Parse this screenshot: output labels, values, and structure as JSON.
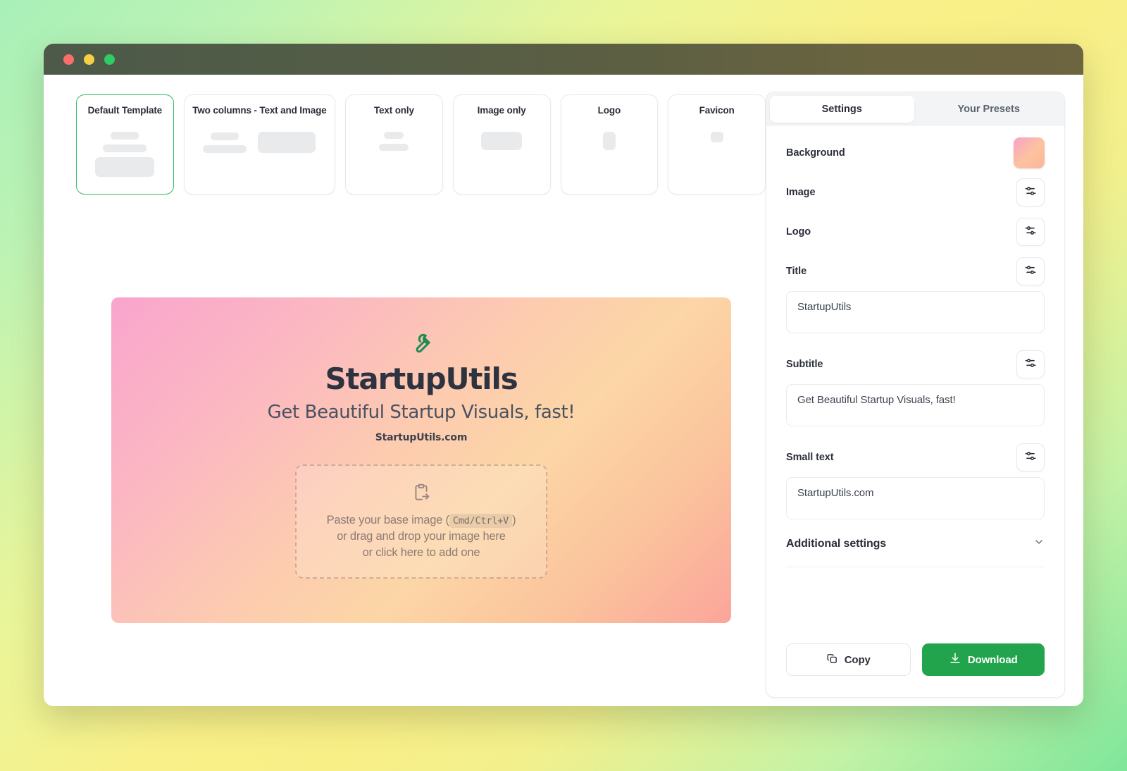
{
  "window": {
    "traffic_lights": [
      "close",
      "minimize",
      "zoom"
    ]
  },
  "templates": [
    {
      "label": "Default Template",
      "selected": true,
      "art": "stacked"
    },
    {
      "label": "Two columns - Text and Image",
      "selected": false,
      "art": "two-col"
    },
    {
      "label": "Text only",
      "selected": false,
      "art": "text"
    },
    {
      "label": "Image only",
      "selected": false,
      "art": "image"
    },
    {
      "label": "Logo",
      "selected": false,
      "art": "logo"
    },
    {
      "label": "Favicon",
      "selected": false,
      "art": "favicon"
    }
  ],
  "canvas": {
    "logo_icon": "wrench-icon",
    "title": "StartupUtils",
    "subtitle": "Get Beautiful Startup Visuals, fast!",
    "small_text": "StartupUtils.com",
    "dropzone": {
      "icon": "clipboard-paste-icon",
      "line1_before": "Paste your base image (",
      "shortcut": "Cmd/Ctrl+V",
      "line1_after": ")",
      "line2": "or drag and drop your image here",
      "line3": "or click here to add one"
    }
  },
  "panel": {
    "tabs": [
      {
        "label": "Settings",
        "active": true
      },
      {
        "label": "Your Presets",
        "active": false
      }
    ],
    "rows": [
      {
        "label": "Background",
        "control": "color-swatch",
        "swatch_colors": [
          "#f9a1c6",
          "#fcc39e",
          "#fbb4a0"
        ]
      },
      {
        "label": "Image",
        "control": "tune-button"
      },
      {
        "label": "Logo",
        "control": "tune-button"
      }
    ],
    "fields": [
      {
        "label": "Title",
        "value": "StartupUtils",
        "control": "tune-button"
      },
      {
        "label": "Subtitle",
        "value": "Get Beautiful Startup Visuals, fast!",
        "control": "tune-button"
      },
      {
        "label": "Small text",
        "value": "StartupUtils.com",
        "control": "tune-button"
      }
    ],
    "additional_settings": {
      "label": "Additional settings",
      "chevron": "chevron-down-icon",
      "expanded": false
    },
    "buttons": {
      "copy": {
        "label": "Copy",
        "icon": "copy-icon"
      },
      "download": {
        "label": "Download",
        "icon": "download-icon",
        "color": "#22a44c"
      }
    }
  }
}
